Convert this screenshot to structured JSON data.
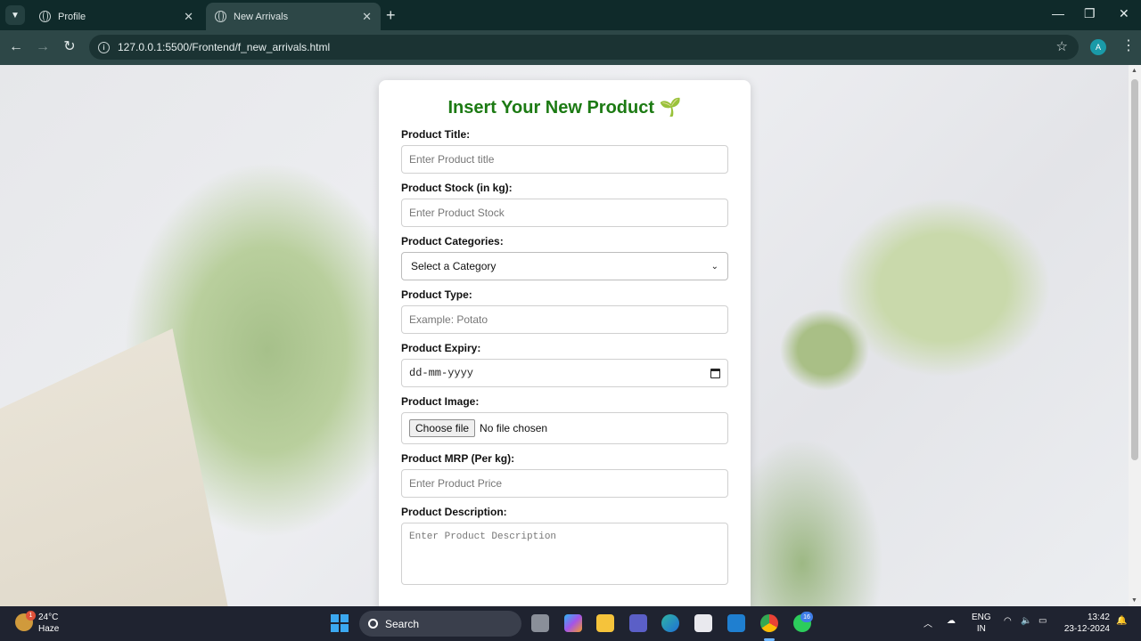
{
  "browser": {
    "tabs": [
      {
        "title": "Profile",
        "active": false
      },
      {
        "title": "New Arrivals",
        "active": true
      }
    ],
    "url": "127.0.0.1:5500/Frontend/f_new_arrivals.html",
    "profile_initial": "A",
    "icons": [
      "tab-search-icon",
      "globe-icon",
      "close-icon",
      "new-tab-icon",
      "back-icon",
      "forward-icon",
      "reload-icon",
      "site-info-icon",
      "star-icon",
      "kebab-menu-icon"
    ]
  },
  "form": {
    "title": "Insert Your New Product 🌱",
    "title_color": "#1c7a13",
    "product_title": {
      "label": "Product Title:",
      "placeholder": "Enter Product title"
    },
    "product_stock": {
      "label": "Product Stock (in kg):",
      "placeholder": "Enter Product Stock"
    },
    "product_categories": {
      "label": "Product Categories:",
      "selected": "Select a Category"
    },
    "product_type": {
      "label": "Product Type:",
      "placeholder": "Example: Potato"
    },
    "product_expiry": {
      "label": "Product Expiry:",
      "value": "dd-mm-yyyy"
    },
    "product_image": {
      "label": "Product Image:",
      "button": "Choose file",
      "status": "No file chosen"
    },
    "product_mrp": {
      "label": "Product MRP (Per kg):",
      "placeholder": "Enter Product Price"
    },
    "product_description": {
      "label": "Product Description:",
      "placeholder": "Enter Product Description"
    }
  },
  "taskbar": {
    "weather": {
      "temp": "24°C",
      "desc": "Haze",
      "badge": "1"
    },
    "search": "Search",
    "whatsapp_badge": "16",
    "language": {
      "line1": "ENG",
      "line2": "IN"
    },
    "clock": {
      "time": "13:42",
      "date": "23-12-2024"
    }
  }
}
